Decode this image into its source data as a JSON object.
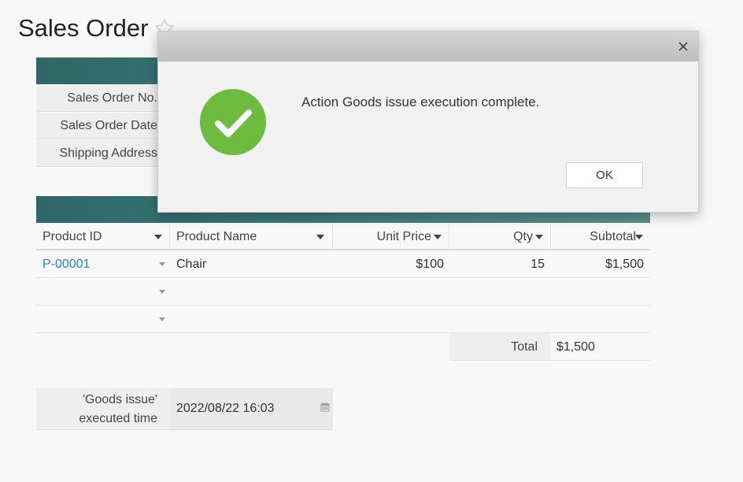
{
  "page": {
    "title": "Sales Order"
  },
  "sections": {
    "order_info": "",
    "item_details": ""
  },
  "form": {
    "fields": [
      {
        "label": "Sales Order No."
      },
      {
        "label": "Sales Order Date"
      },
      {
        "label": "Shipping Address"
      }
    ]
  },
  "grid": {
    "columns": [
      {
        "label": "Product ID"
      },
      {
        "label": "Product Name"
      },
      {
        "label": "Unit Price"
      },
      {
        "label": "Qty"
      },
      {
        "label": "Subtotal"
      }
    ],
    "rows": [
      {
        "product_id": "P-00001",
        "product_name": "Chair",
        "unit_price": "$100",
        "qty": "15",
        "subtotal": "$1,500"
      },
      {
        "product_id": "",
        "product_name": "",
        "unit_price": "",
        "qty": "",
        "subtotal": ""
      },
      {
        "product_id": "",
        "product_name": "",
        "unit_price": "",
        "qty": "",
        "subtotal": ""
      }
    ],
    "total_label": "Total",
    "total_value": "$1,500"
  },
  "exec_time": {
    "label_line1": "'Goods issue'",
    "label_line2": "executed time",
    "value": "2022/08/22 16:03"
  },
  "dialog": {
    "message": "Action Goods issue execution complete.",
    "ok_label": "OK"
  },
  "colors": {
    "header_band": "#2f6668",
    "success_green": "#6dbb3f",
    "link_blue": "#2a83c6"
  }
}
